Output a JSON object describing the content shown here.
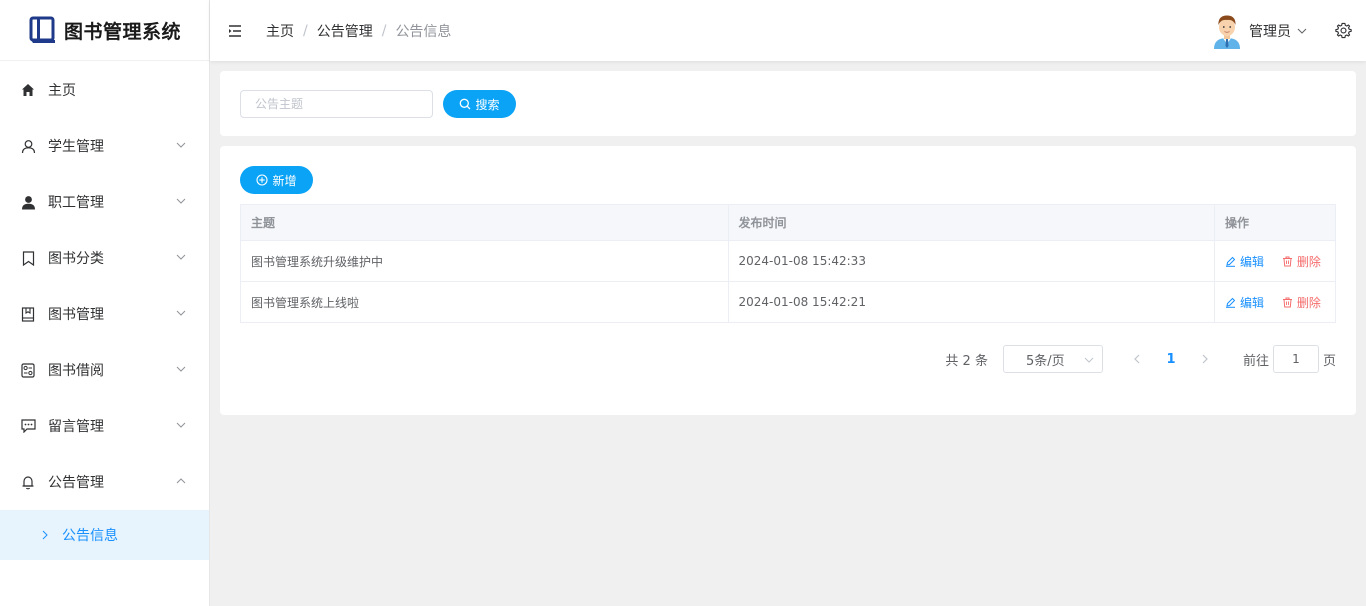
{
  "app": {
    "title": "图书管理系统"
  },
  "sidebar": {
    "items": [
      {
        "label": "主页",
        "icon": "home-icon"
      },
      {
        "label": "学生管理",
        "icon": "user-icon"
      },
      {
        "label": "职工管理",
        "icon": "user-filled-icon"
      },
      {
        "label": "图书分类",
        "icon": "bookmark-icon"
      },
      {
        "label": "图书管理",
        "icon": "notebook-icon"
      },
      {
        "label": "图书借阅",
        "icon": "tickets-icon"
      },
      {
        "label": "留言管理",
        "icon": "chat-dot-icon"
      },
      {
        "label": "公告管理",
        "icon": "bell-icon"
      }
    ],
    "sub_items": [
      {
        "label": "公告信息"
      }
    ]
  },
  "header": {
    "breadcrumb": [
      "主页",
      "公告管理",
      "公告信息"
    ],
    "separator": "/",
    "user_name": "管理员"
  },
  "search": {
    "placeholder": "公告主题",
    "value": "",
    "button_label": "搜索"
  },
  "toolbar": {
    "add_label": "新增"
  },
  "table": {
    "columns": [
      "主题",
      "发布时间",
      "操作"
    ],
    "rows": [
      {
        "title": "图书管理系统升级维护中",
        "time": "2024-01-08 15:42:33"
      },
      {
        "title": "图书管理系统上线啦",
        "time": "2024-01-08 15:42:21"
      }
    ],
    "edit_label": "编辑",
    "delete_label": "删除"
  },
  "pagination": {
    "total_text": "共 2 条",
    "page_size": "5条/页",
    "current_page": "1",
    "goto_label": "前往",
    "goto_value": "1",
    "page_suffix": "页"
  },
  "colors": {
    "primary": "#0aa3f5",
    "link": "#1890ff",
    "danger": "#f56c6c",
    "active_bg": "#e8f4fd"
  }
}
